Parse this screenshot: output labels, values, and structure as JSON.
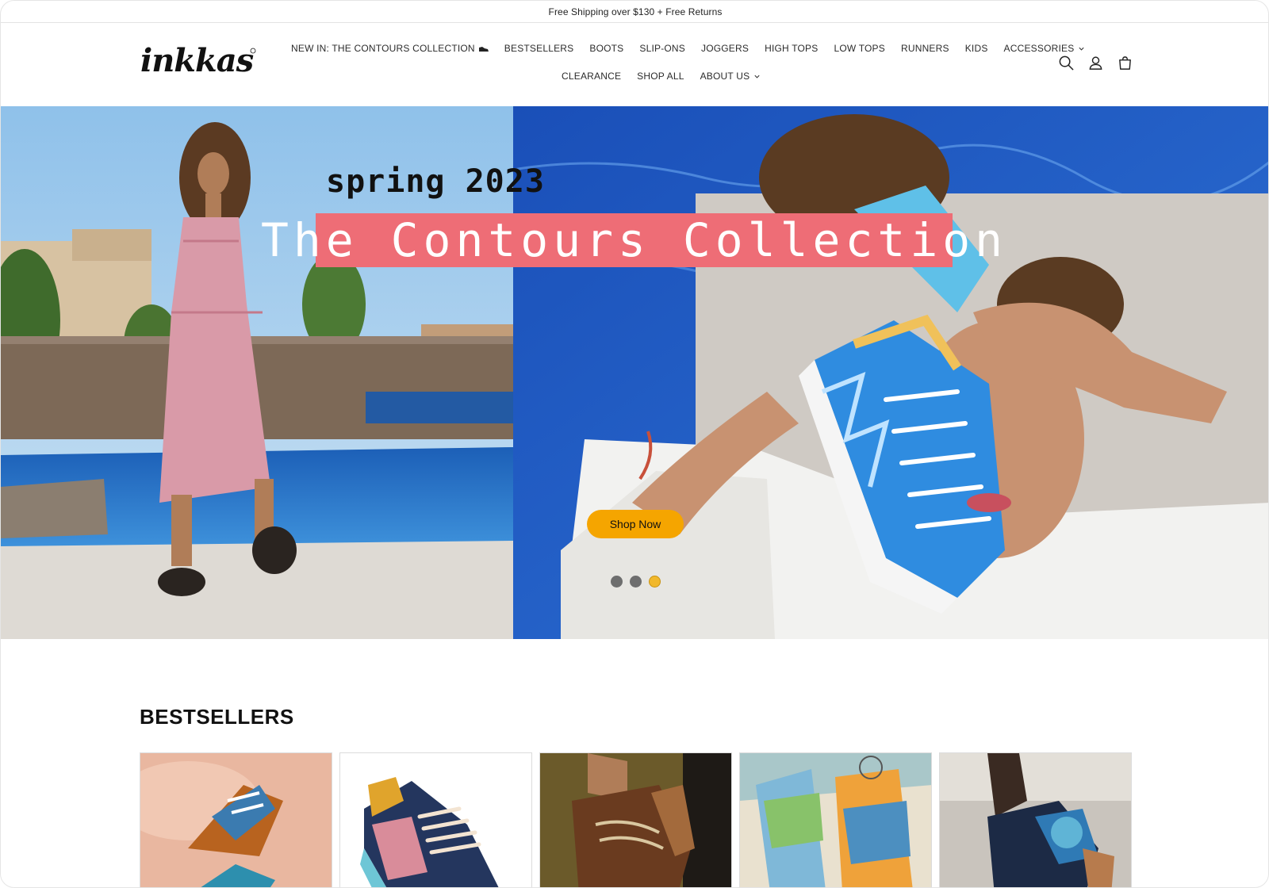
{
  "announcement": {
    "text": "Free Shipping over $130 + Free Returns"
  },
  "header": {
    "logo_text": "inkkas",
    "nav_row1": [
      {
        "label": "NEW IN: THE CONTOURS COLLECTION"
      },
      {
        "label": "BESTSELLERS"
      },
      {
        "label": "BOOTS"
      },
      {
        "label": "SLIP-ONS"
      },
      {
        "label": "JOGGERS"
      },
      {
        "label": "HIGH TOPS"
      },
      {
        "label": "LOW TOPS"
      },
      {
        "label": "RUNNERS"
      },
      {
        "label": "KIDS"
      },
      {
        "label": "ACCESSORIES"
      }
    ],
    "nav_row2": [
      {
        "label": "CLEARANCE"
      },
      {
        "label": "SHOP ALL"
      },
      {
        "label": "ABOUT US"
      }
    ],
    "icons": [
      "search-icon",
      "account-icon",
      "cart-icon"
    ]
  },
  "hero": {
    "subtitle": "spring 2023",
    "title": "The Contours Collection",
    "cta_label": "Shop Now",
    "slides_count": 3,
    "active_slide": 3,
    "title_bg_color": "#ee6d76",
    "cta_color": "#f5a500"
  },
  "bestsellers": {
    "heading": "BESTSELLERS",
    "products": [
      {
        "image": "colorful-sneakers-on-pillow"
      },
      {
        "image": "floral-navy-runner"
      },
      {
        "image": "brown-boots-in-hand"
      },
      {
        "image": "illustrated-slip-ons"
      },
      {
        "image": "embroidered-ankle-boot"
      }
    ]
  }
}
